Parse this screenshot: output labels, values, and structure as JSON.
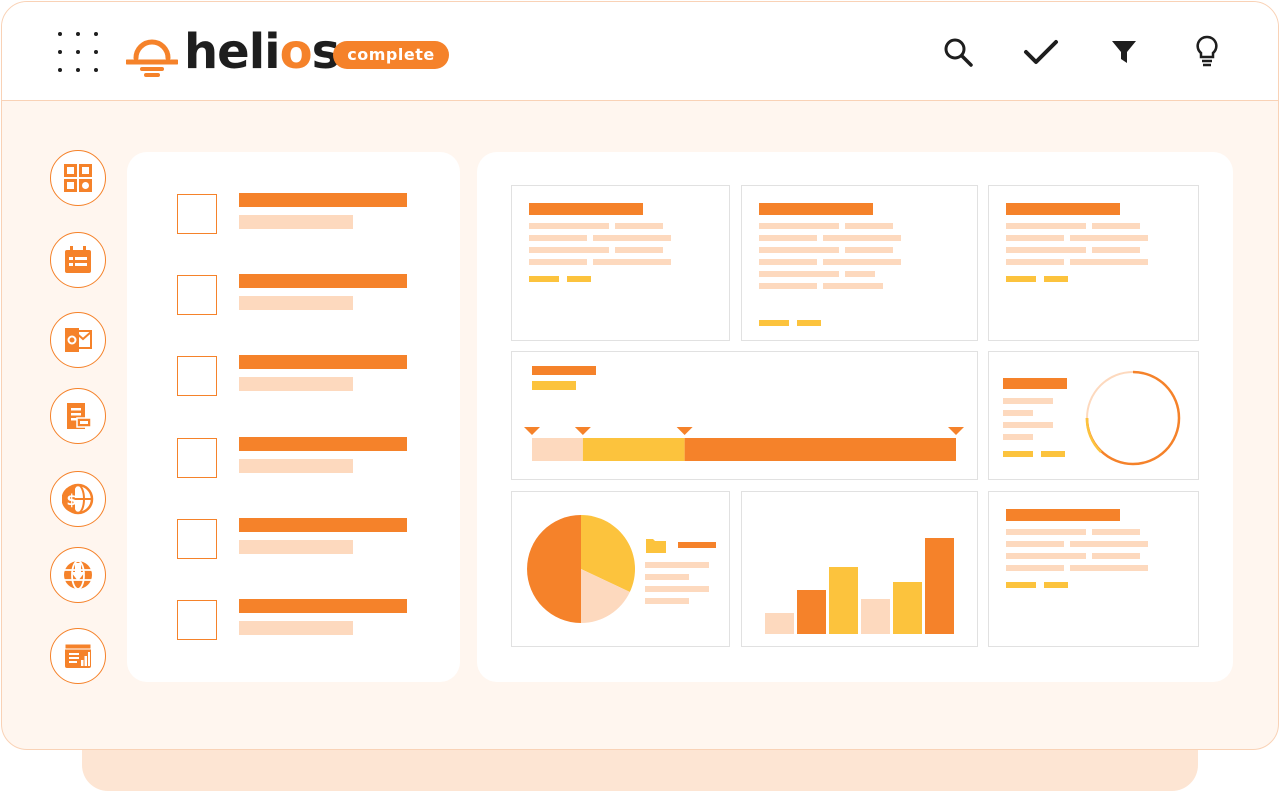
{
  "brand": {
    "name": "heli",
    "name_o": "o",
    "name_end": "s",
    "badge": "complete",
    "accent": "#f5822a",
    "accent_light": "#fdd9be",
    "accent_yellow": "#fcc33d"
  },
  "toolbar": {
    "icons": [
      "search-icon",
      "check-icon",
      "filter-icon",
      "lightbulb-icon"
    ]
  },
  "side_rail": {
    "icons": [
      "dashboard-grid-icon",
      "calendar-list-icon",
      "outlook-mail-icon",
      "ids-document-icon",
      "dollar-globe-icon",
      "globe-download-icon",
      "report-chart-icon"
    ]
  },
  "tasks": {
    "count": 6
  },
  "widgets": {
    "timeline_segments": [
      0.12,
      0.36,
      1.0
    ],
    "pie_slices": [
      {
        "fraction": 0.5,
        "color": "#f5822a"
      },
      {
        "fraction": 0.32,
        "color": "#fcc33d"
      },
      {
        "fraction": 0.18,
        "color": "#fdd9be"
      }
    ],
    "bars": [
      {
        "value": 21,
        "color": "#fdd9be"
      },
      {
        "value": 44,
        "color": "#f5822a"
      },
      {
        "value": 67,
        "color": "#fcc33d"
      },
      {
        "value": 35,
        "color": "#fdd9be"
      },
      {
        "value": 52,
        "color": "#fcc33d"
      },
      {
        "value": 96,
        "color": "#f5822a"
      }
    ]
  }
}
